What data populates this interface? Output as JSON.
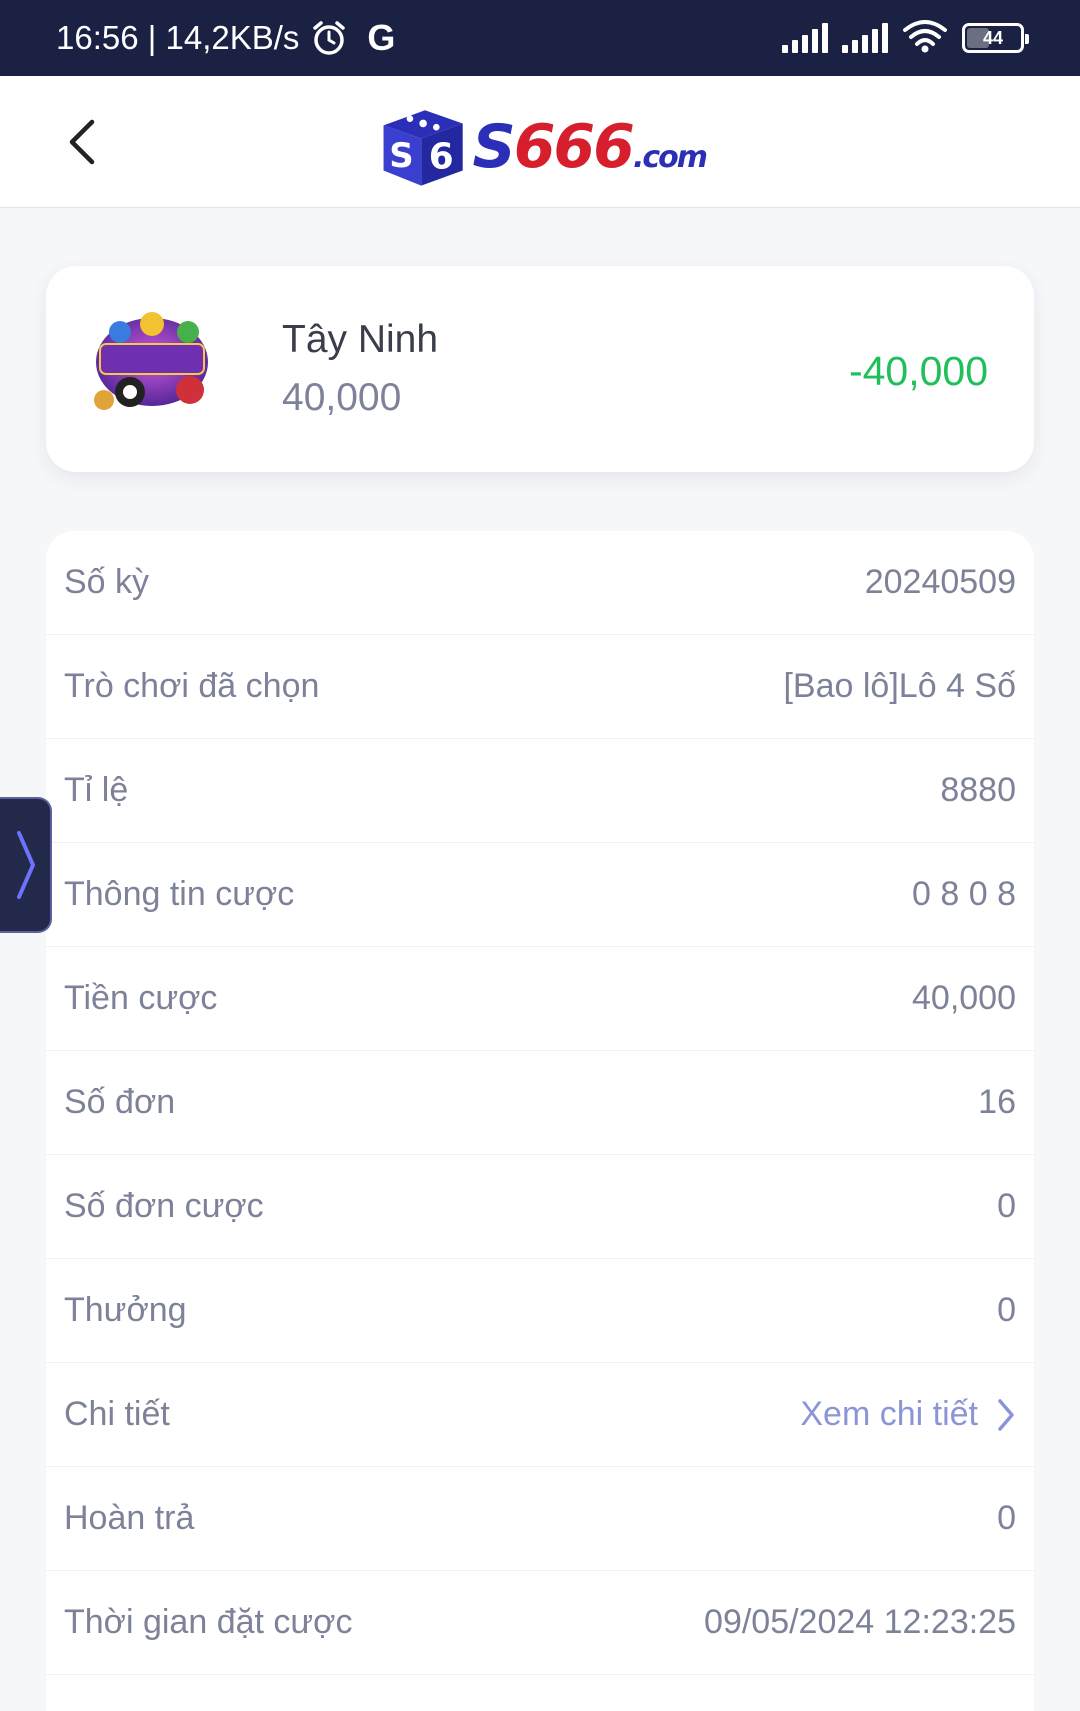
{
  "status_bar": {
    "time_speed": "16:56 | 14,2KB/s",
    "google_letter": "G",
    "battery": "44",
    "icons": [
      "alarm-icon",
      "google-icon",
      "signal-icon",
      "signal-icon",
      "wifi-icon",
      "battery-icon"
    ]
  },
  "header": {
    "logo_text_a": "S",
    "logo_text_b": "666",
    "logo_text_c": ".com",
    "back_icon": "chevron-left-icon"
  },
  "summary": {
    "game_name": "Tây Ninh",
    "stake": "40,000",
    "result": "-40,000",
    "result_color": "#1fbf5a"
  },
  "details": {
    "rows": [
      {
        "label": "Số kỳ",
        "value": "20240509"
      },
      {
        "label": "Trò chơi đã chọn",
        "value": "[Bao lô]Lô 4 Số"
      },
      {
        "label": "Tỉ lệ",
        "value": "8880"
      },
      {
        "label": "Thông tin cược",
        "value": "0 8 0 8"
      },
      {
        "label": "Tiền cược",
        "value": "40,000"
      },
      {
        "label": "Số đơn",
        "value": "16"
      },
      {
        "label": "Số đơn cược",
        "value": "0"
      },
      {
        "label": "Thưởng",
        "value": "0"
      },
      {
        "label": "Chi tiết",
        "value": "Xem chi tiết"
      },
      {
        "label": "Hoàn trả",
        "value": "0"
      },
      {
        "label": "Thời gian đặt cược",
        "value": "09/05/2024 12:23:25"
      }
    ]
  },
  "side_tab": {
    "icon": "chevron-right-icon"
  }
}
